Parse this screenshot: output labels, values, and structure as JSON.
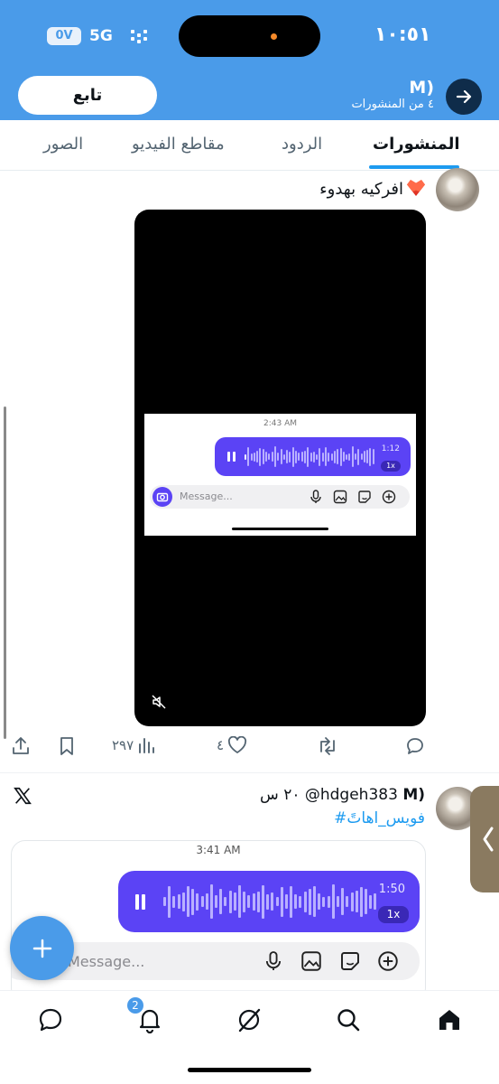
{
  "status": {
    "time": "١٠:٥١",
    "battery": "0V",
    "network": "5G"
  },
  "header": {
    "name": "M)",
    "post_count": "٤ من المنشورات",
    "follow_label": "تابع"
  },
  "tabs": [
    {
      "label": "المنشورات",
      "active": true
    },
    {
      "label": "الردود",
      "active": false
    },
    {
      "label": "مقاطع الفيديو",
      "active": false
    },
    {
      "label": "الصور",
      "active": false
    }
  ],
  "post1": {
    "text": "افركيه بهدوء",
    "video_screenshot": {
      "time": "2:43 AM",
      "duration": "1:12",
      "speed": "1x",
      "placeholder": "Message..."
    },
    "actions": {
      "views": "٢٩٧",
      "likes": "٤"
    }
  },
  "post2": {
    "name": "M)",
    "handle": "@hdgeh383",
    "time": "٢٠ س",
    "hashtag": "#فويس_اهاتً",
    "voice_screenshot": {
      "time": "3:41 AM",
      "duration": "1:50",
      "speed": "1x",
      "placeholder": "Message..."
    }
  },
  "nav": {
    "notifications_badge": "2"
  },
  "colors": {
    "header": "#4a9be9",
    "accent": "#1d9bf0",
    "voice_bubble": "#5b43f5"
  }
}
